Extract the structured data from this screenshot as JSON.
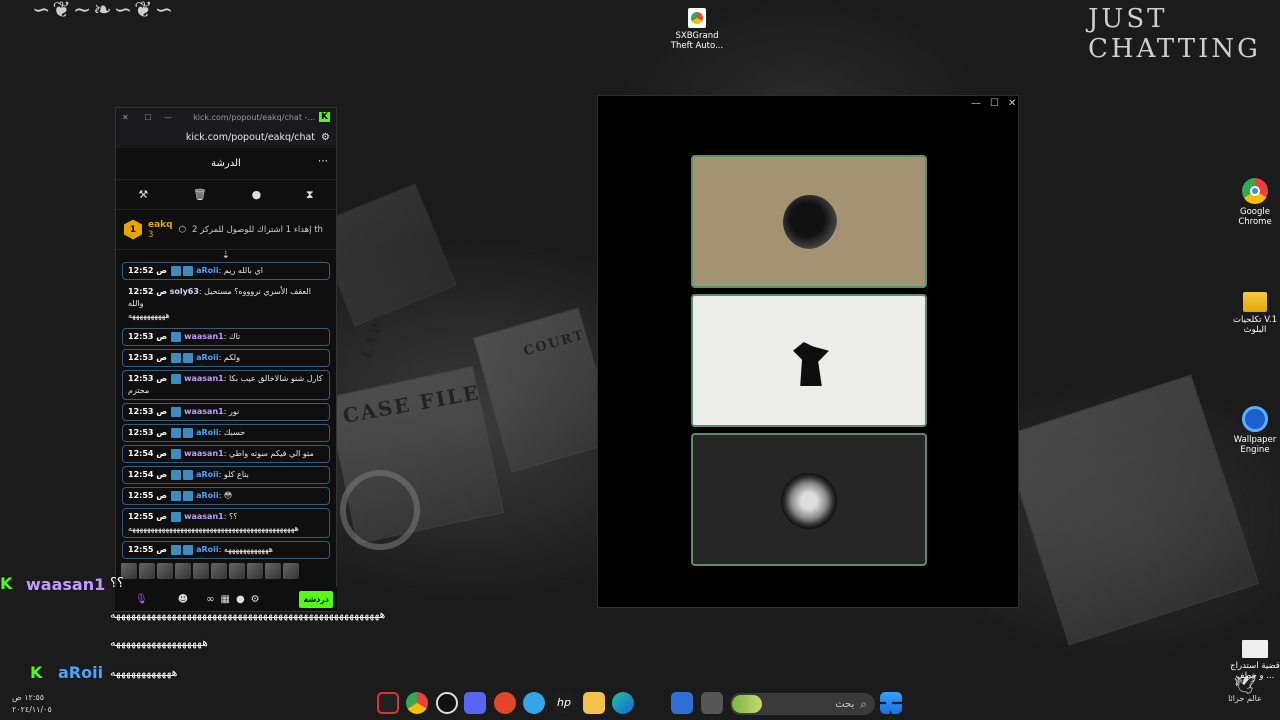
{
  "desktop": {
    "overlay_title": "JUST CHATTING",
    "icons": [
      {
        "label": "SXBGrand Theft Auto...",
        "icon": "chrome-shortcut-icon"
      },
      {
        "label": "Google Chrome",
        "icon": "chrome-icon"
      },
      {
        "label": "تكلحيات V.1 البلوث",
        "icon": "folder-icon"
      },
      {
        "label": "Wallpaper Engine",
        "icon": "wallpaper-engine-icon"
      },
      {
        "label": "قضية استدراج ... و خطف",
        "icon": "document-icon"
      }
    ],
    "bg_papers": [
      "CASE FILE",
      "COURT REC",
      "LAW"
    ],
    "corner_label": "عالم جرائا"
  },
  "chat_popout": {
    "window_title": "kick.com/popout/eakq/chat -...",
    "url": "kick.com/popout/eakq/chat",
    "header_title": "الدرشة",
    "pinned": {
      "streamer": "eakq",
      "rank": "1",
      "count": "3",
      "text": "إهداء 1 اشتراك للوصول للمركز 2 th"
    },
    "messages": [
      {
        "time": "12:52 ص",
        "user": "aRoii",
        "color": "#4aa3ff",
        "text": "اي بالله ريم",
        "badges": 2,
        "border": true
      },
      {
        "time": "12:52 ص",
        "user": "soly63",
        "color": "#d7d7ff",
        "text": "العقف الأسري نروووه؟ مستحيل والله",
        "badges": 0,
        "border": false,
        "extra": "ههههههههههه"
      },
      {
        "time": "12:53 ص",
        "user": "waasan1",
        "color": "#c39bff",
        "text": "تاك",
        "badges": 1,
        "border": true
      },
      {
        "time": "12:53 ص",
        "user": "aRoii",
        "color": "#4aa3ff",
        "text": "ولكم",
        "badges": 2,
        "border": true
      },
      {
        "time": "12:53 ص",
        "user": "waasan1",
        "color": "#c39bff",
        "text": "كارل شنو شالاخالق عيب بكا محترم",
        "badges": 1,
        "border": true
      },
      {
        "time": "12:53 ص",
        "user": "waasan1",
        "color": "#c39bff",
        "text": "نور",
        "badges": 1,
        "border": true
      },
      {
        "time": "12:53 ص",
        "user": "aRoii",
        "color": "#4aa3ff",
        "text": "حسبك",
        "badges": 2,
        "border": true
      },
      {
        "time": "12:54 ص",
        "user": "waasan1",
        "color": "#c39bff",
        "text": "متو الي فيكم سوته واطي",
        "badges": 1,
        "border": true
      },
      {
        "time": "12:54 ص",
        "user": "aRoii",
        "color": "#4aa3ff",
        "text": "بتاع كلو",
        "badges": 2,
        "border": true
      },
      {
        "time": "12:55 ص",
        "user": "aRoii",
        "color": "#4aa3ff",
        "text": "😳",
        "badges": 2,
        "border": true
      },
      {
        "time": "12:55 ص",
        "user": "waasan1",
        "color": "#c39bff",
        "text": "؟؟",
        "badges": 1,
        "border": true,
        "extra": "هههههههههههههههههههههههههههههههههههههههههههههه"
      },
      {
        "time": "12:55 ص",
        "user": "aRoii",
        "color": "#4aa3ff",
        "text": "ههههههههههههه",
        "badges": 2,
        "border": true
      }
    ],
    "send_label": "دردشة"
  },
  "overlay_chat": [
    {
      "user": "waasan1",
      "text": "؟؟",
      "line2": "هههههههههههههههههههههههههههههههههههههههههههههههههههههه",
      "line3": "ههههههههههههههههههه"
    },
    {
      "user": "aRoii",
      "text": "ههههههههههههه"
    }
  ],
  "taskbar": {
    "search_placeholder": "بحث",
    "time": "١٢:٥٥ ص",
    "date": "٢٠٢٤/١١/٠٥",
    "colors": {
      "accent": "#53fc18",
      "user_a": "#4aa3ff",
      "user_w": "#c39bff"
    }
  }
}
